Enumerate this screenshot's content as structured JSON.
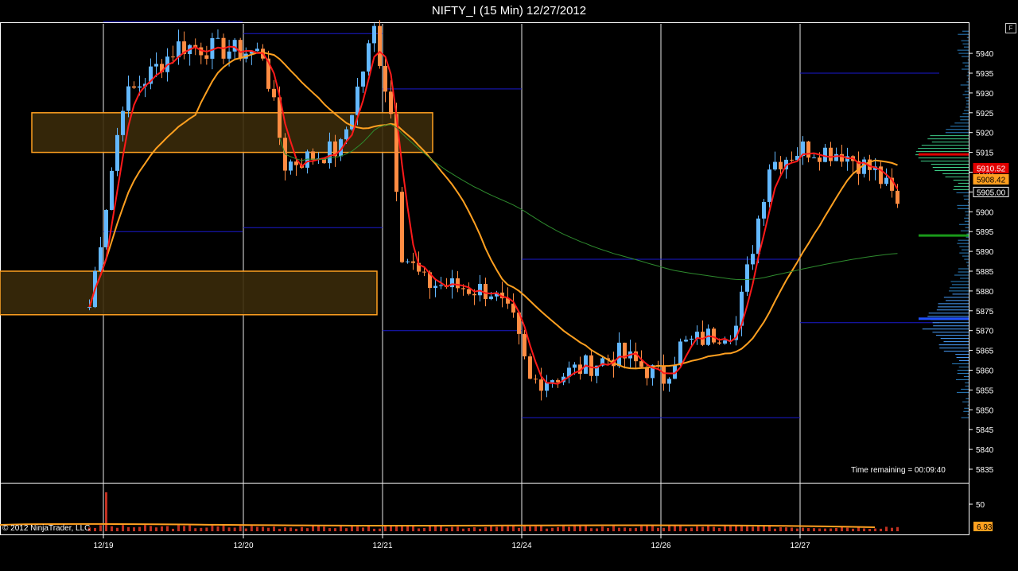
{
  "window": {
    "title": "NIFTY_I (15 Min)  12/27/2012",
    "f_button": "F"
  },
  "status": {
    "time_remaining": "Time remaining = 00:09:40",
    "copyright": "© 2012 NinjaTrader, LLC"
  },
  "colors": {
    "background": "#000000",
    "up_candle": "#63B8FF",
    "down_candle": "#FF8C42",
    "fast_ma": "#FF1A1A",
    "slow_ma": "#FFA020",
    "vwap": "#2E8B2E",
    "range_lines": "#1A1AD0",
    "zone_fill": "#3A2A0A",
    "zone_border": "#FFA020",
    "volume_bar": "#C03020"
  },
  "chart_data": {
    "type": "candlestick",
    "title": "NIFTY_I (15 Min)  12/27/2012",
    "ylim": [
      5832,
      5948
    ],
    "y_ticks": [
      5835,
      5840,
      5845,
      5850,
      5855,
      5860,
      5865,
      5870,
      5875,
      5880,
      5885,
      5890,
      5895,
      5900,
      5905,
      5910,
      5915,
      5920,
      5925,
      5930,
      5935,
      5940
    ],
    "x_ticks": [
      "12/19",
      "12/20",
      "12/21",
      "12/24",
      "12/26",
      "12/27"
    ],
    "price_labels": [
      {
        "value": "5910.52",
        "bg": "#E00000",
        "fg": "#FFFFFF"
      },
      {
        "value": "5908.42",
        "bg": "#FFA020",
        "fg": "#000000"
      },
      {
        "value": "5905.00",
        "bg": "#000000",
        "fg": "#FFFFFF"
      }
    ],
    "volume_ticks": [
      50
    ],
    "volume_label": "6.93",
    "zones": [
      {
        "from": 5915,
        "to": 5925
      },
      {
        "from": 5874,
        "to": 5885
      }
    ],
    "anchors": [
      {
        "x": "12/18 14:45",
        "close": 5876
      },
      {
        "x": "12/19 10:00",
        "close": 5928
      },
      {
        "x": "12/19 12:30",
        "close": 5942
      },
      {
        "x": "12/20 10:00",
        "close": 5940
      },
      {
        "x": "12/20 11:00",
        "close": 5912
      },
      {
        "x": "12/20 13:30",
        "close": 5916
      },
      {
        "x": "12/20 14:30",
        "close": 5936
      },
      {
        "x": "12/20 15:00",
        "close": 5946
      },
      {
        "x": "12/21 09:30",
        "close": 5925
      },
      {
        "x": "12/21 10:00",
        "close": 5890
      },
      {
        "x": "12/21 11:00",
        "close": 5882
      },
      {
        "x": "12/21 14:00",
        "close": 5880
      },
      {
        "x": "12/21 15:00",
        "close": 5872
      },
      {
        "x": "12/24 09:30",
        "close": 5857
      },
      {
        "x": "12/24 11:00",
        "close": 5859
      },
      {
        "x": "12/24 13:30",
        "close": 5864
      },
      {
        "x": "12/24 15:30",
        "close": 5858
      },
      {
        "x": "12/26 10:00",
        "close": 5866
      },
      {
        "x": "12/26 12:30",
        "close": 5871
      },
      {
        "x": "12/26 14:00",
        "close": 5912
      },
      {
        "x": "12/26 15:30",
        "close": 5916
      },
      {
        "x": "12/27 11:00",
        "close": 5915
      },
      {
        "x": "12/27 12:30",
        "close": 5910
      },
      {
        "x": "12/27 13:30",
        "close": 5902
      }
    ],
    "session_ranges": [
      {
        "session": "12/19",
        "high": 5948,
        "low": 5895
      },
      {
        "session": "12/20",
        "high": 5945,
        "low": 5896
      },
      {
        "session": "12/21",
        "high": 5931,
        "low": 5870
      },
      {
        "session": "12/24",
        "high": 5888,
        "low": 5848
      },
      {
        "session": "12/26",
        "high": 5888,
        "low": 5848
      },
      {
        "session": "12/27",
        "high": 5935,
        "low": 5872
      }
    ]
  }
}
